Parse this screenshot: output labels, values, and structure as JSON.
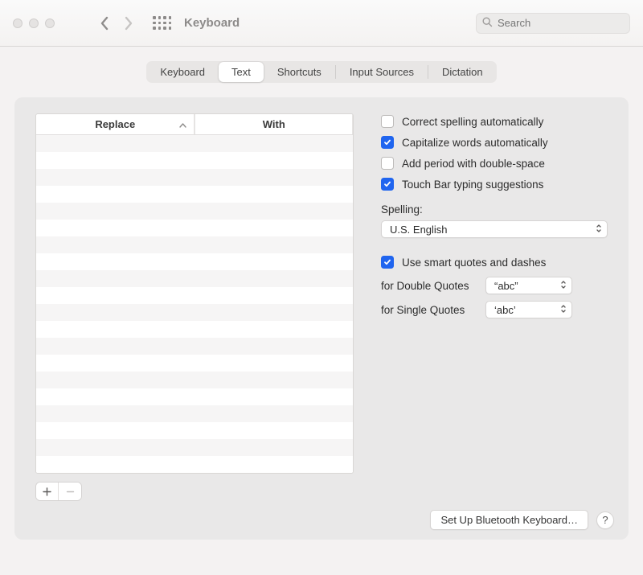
{
  "window": {
    "title": "Keyboard"
  },
  "search": {
    "placeholder": "Search"
  },
  "tabs": {
    "keyboard": "Keyboard",
    "text": "Text",
    "shortcuts": "Shortcuts",
    "input_sources": "Input Sources",
    "dictation": "Dictation",
    "active": "text"
  },
  "table": {
    "col_replace": "Replace",
    "col_with": "With"
  },
  "options": {
    "correct_spelling": {
      "label": "Correct spelling automatically",
      "checked": false
    },
    "capitalize": {
      "label": "Capitalize words automatically",
      "checked": true
    },
    "period_double_space": {
      "label": "Add period with double-space",
      "checked": false
    },
    "touch_bar": {
      "label": "Touch Bar typing suggestions",
      "checked": true
    },
    "smart_quotes": {
      "label": "Use smart quotes and dashes",
      "checked": true
    }
  },
  "spelling": {
    "label": "Spelling:",
    "value": "U.S. English"
  },
  "quotes": {
    "double_label": "for Double Quotes",
    "double_value": "“abc”",
    "single_label": "for Single Quotes",
    "single_value": "‘abc’"
  },
  "footer": {
    "bluetooth_button": "Set Up Bluetooth Keyboard…",
    "help": "?"
  }
}
